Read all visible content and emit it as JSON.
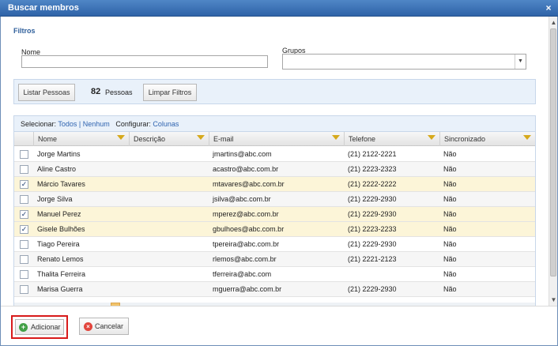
{
  "window": {
    "title": "Buscar membros",
    "close_glyph": "×"
  },
  "filters": {
    "title": "Filtros",
    "nome_label": "Nome",
    "nome_value": "",
    "grupos_label": "Grupos",
    "grupos_value": ""
  },
  "actions": {
    "list_label": "Listar Pessoas",
    "count": "82",
    "count_label": "Pessoas",
    "clear_label": "Limpar Filtros"
  },
  "grid": {
    "toolbar": {
      "select_label": "Selecionar:",
      "all_label": "Todos",
      "separator": "|",
      "none_label": "Nenhum",
      "configure_label": "Configurar:",
      "columns_label": "Colunas"
    },
    "columns": [
      "Nome",
      "Descrição",
      "E-mail",
      "Telefone",
      "Sincronizado"
    ],
    "rows": [
      {
        "checked": false,
        "nome": "Jorge Martins",
        "descricao": "",
        "email": "jmartins@abc.com",
        "telefone": "(21) 2122-2221",
        "sincronizado": "Não"
      },
      {
        "checked": false,
        "nome": "Aline Castro",
        "descricao": "",
        "email": "acastro@abc.com.br",
        "telefone": "(21) 2223-2323",
        "sincronizado": "Não"
      },
      {
        "checked": true,
        "nome": "Márcio Tavares",
        "descricao": "",
        "email": "mtavares@abc.com.br",
        "telefone": "(21) 2222-2222",
        "sincronizado": "Não"
      },
      {
        "checked": false,
        "nome": "Jorge Silva",
        "descricao": "",
        "email": "jsilva@abc.com.br",
        "telefone": "(21) 2229-2930",
        "sincronizado": "Não"
      },
      {
        "checked": true,
        "nome": "Manuel Perez",
        "descricao": "",
        "email": "mperez@abc.com.br",
        "telefone": "(21) 2229-2930",
        "sincronizado": "Não"
      },
      {
        "checked": true,
        "nome": "Gisele Bulhões",
        "descricao": "",
        "email": "gbulhoes@abc.com.br",
        "telefone": "(21) 2223-2233",
        "sincronizado": "Não"
      },
      {
        "checked": false,
        "nome": "Tiago Pereira",
        "descricao": "",
        "email": "tpereira@abc.com.br",
        "telefone": "(21) 2229-2930",
        "sincronizado": "Não"
      },
      {
        "checked": false,
        "nome": "Renato Lemos",
        "descricao": "",
        "email": "rlemos@abc.com.br",
        "telefone": "(21) 2221-2123",
        "sincronizado": "Não"
      },
      {
        "checked": false,
        "nome": "Thalita Ferreira",
        "descricao": "",
        "email": "tferreira@abc.com",
        "telefone": "",
        "sincronizado": "Não"
      },
      {
        "checked": false,
        "nome": "Marisa Guerra",
        "descricao": "",
        "email": "mguerra@abc.com.br",
        "telefone": "(21) 2229-2930",
        "sincronizado": "Não"
      }
    ]
  },
  "footer": {
    "add_label": "Adicionar",
    "cancel_label": "Cancelar"
  },
  "icons": {
    "filter": "funnel-icon",
    "add": "plus-circle-icon",
    "cancel": "x-circle-icon",
    "check": "✓"
  },
  "colors": {
    "title_bar": "#2f63a8",
    "selected_row": "#fcf5d8",
    "highlight_border": "#d81a1a",
    "link": "#2f64b0"
  }
}
